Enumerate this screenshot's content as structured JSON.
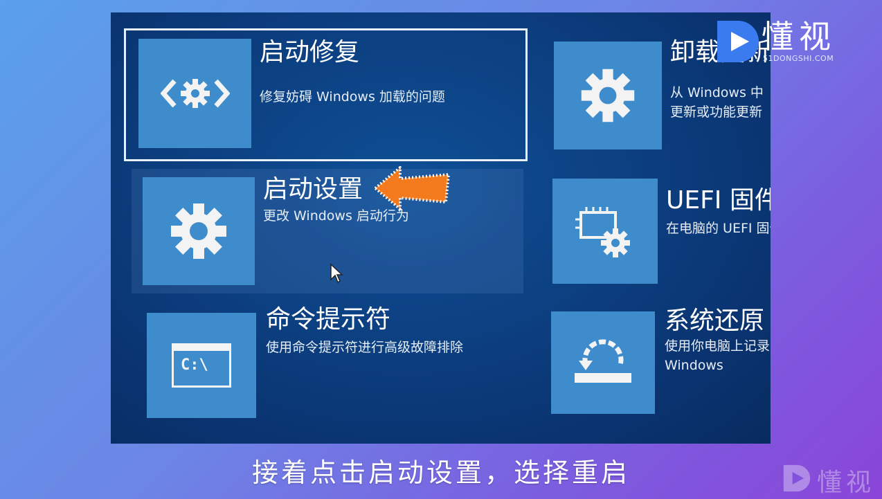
{
  "menu": {
    "startup_repair": {
      "title": "启动修复",
      "desc": "修复妨碍 Windows 加载的问题"
    },
    "startup_settings": {
      "title": "启动设置",
      "desc": "更改 Windows 启动行为"
    },
    "command_prompt": {
      "title": "命令提示符",
      "desc": "使用命令提示符进行高级故障排除",
      "icon_text": "C:\\"
    },
    "uninstall_updates": {
      "title": "卸载更新",
      "desc_line1": "从 Windows 中",
      "desc_line2": "更新或功能更新"
    },
    "uefi_firmware": {
      "title": "UEFI 固件",
      "desc": "在电脑的 UEFI 固件"
    },
    "system_restore": {
      "title": "系统还原",
      "desc_line1": "使用你电脑上记录",
      "desc_line2": "Windows"
    }
  },
  "caption": "接着点击启动设置，选择重启",
  "logo": {
    "text": "懂视",
    "url": "51DONGSHI.COM"
  },
  "watermark": {
    "text": "懂视"
  },
  "colors": {
    "tile": "#3e8ccb",
    "arrow": "#f47b1d",
    "screen": "#0c3f80"
  }
}
